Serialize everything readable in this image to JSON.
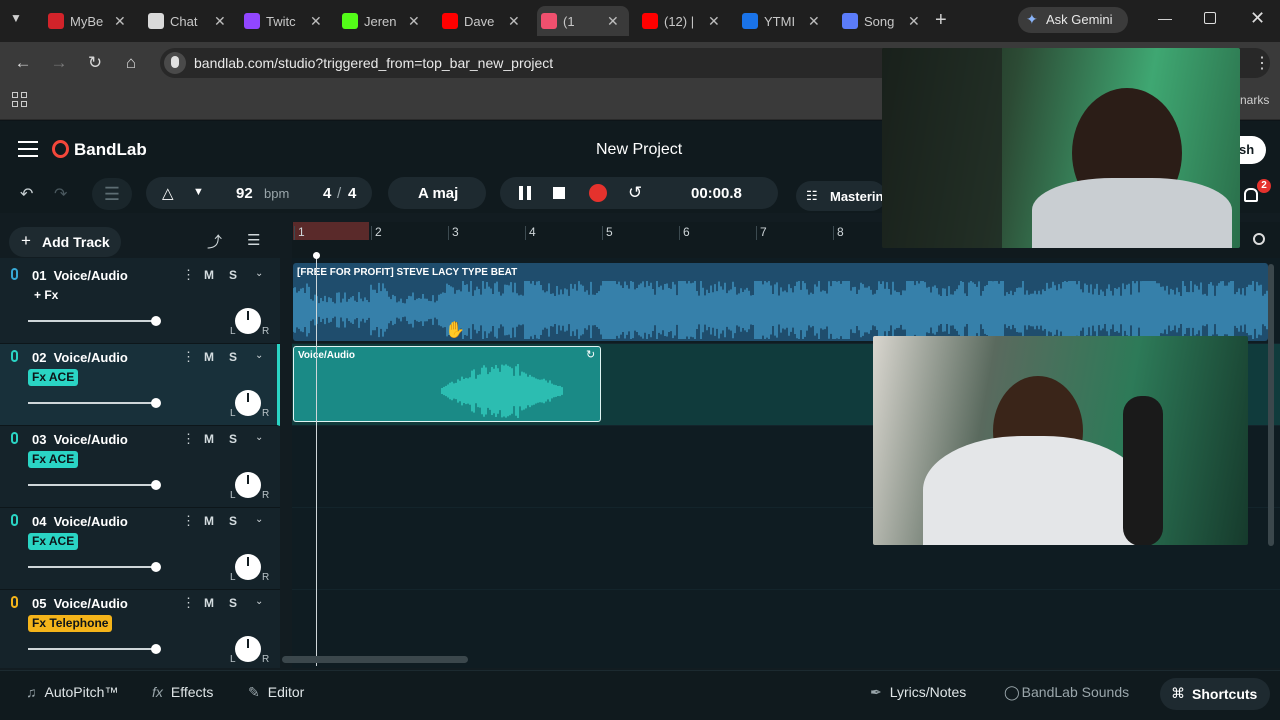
{
  "browser": {
    "tabs": [
      {
        "label": "MyBe",
        "favicon_color": "#d2232a"
      },
      {
        "label": "Chat",
        "favicon_color": "#d9d9d9"
      },
      {
        "label": "Twitc",
        "favicon_color": "#9146ff"
      },
      {
        "label": "Jeren",
        "favicon_color": "#53fc18"
      },
      {
        "label": "Dave",
        "favicon_color": "#ff0000"
      },
      {
        "label": "(1",
        "favicon_color": "#f0506e"
      },
      {
        "label": "(12) |",
        "favicon_color": "#ff0000"
      },
      {
        "label": "YTMI",
        "favicon_color": "#1a73e8"
      },
      {
        "label": "Song",
        "favicon_color": "#5b7cfa"
      }
    ],
    "new_tab": "+",
    "ask_gemini": "Ask Gemini",
    "url": "bandlab.com/studio?triggered_from=top_bar_new_project",
    "bookmarks_fragment": "narks"
  },
  "app": {
    "logo": "BandLab",
    "project_title": "New Project",
    "publish_fragment": "sh",
    "notification_count": "2",
    "tempo": "92",
    "tempo_unit": "bpm",
    "time_sig_num": "4",
    "time_sig_sep": "/",
    "time_sig_den": "4",
    "key": "A maj",
    "time": "00:00.8",
    "mastering": "Mastering",
    "add_track": "Add Track",
    "ruler": [
      "1",
      "2",
      "3",
      "4",
      "5",
      "6",
      "7",
      "8"
    ],
    "tracks": [
      {
        "name": "01  Voice/Audio",
        "fx": "+ Fx",
        "fx_color": "",
        "icon_color": "#37a8d4"
      },
      {
        "name": "02  Voice/Audio",
        "fx": "Fx ACE",
        "fx_color": "#2ad4c4",
        "icon_color": "#2ad4c4"
      },
      {
        "name": "03  Voice/Audio",
        "fx": "Fx ACE",
        "fx_color": "#2ad4c4",
        "icon_color": "#2ad4c4"
      },
      {
        "name": "04  Voice/Audio",
        "fx": "Fx ACE",
        "fx_color": "#2ad4c4",
        "icon_color": "#2ad4c4"
      },
      {
        "name": "05  Voice/Audio",
        "fx": "Fx Telephone",
        "fx_color": "#f4b41a",
        "icon_color": "#f4b41a"
      }
    ],
    "m_label": "M",
    "s_label": "S",
    "l_label": "L",
    "r_label": "R",
    "clips": {
      "beat": "[FREE FOR PROFIT] STEVE LACY TYPE BEAT",
      "vocal": "Voice/Audio"
    },
    "bottom": {
      "autopitch": "AutoPitch™",
      "effects": "Effects",
      "editor": "Editor",
      "lyrics": "Lyrics/Notes",
      "sounds": "BandLab Sounds",
      "shortcuts": "Shortcuts"
    }
  }
}
